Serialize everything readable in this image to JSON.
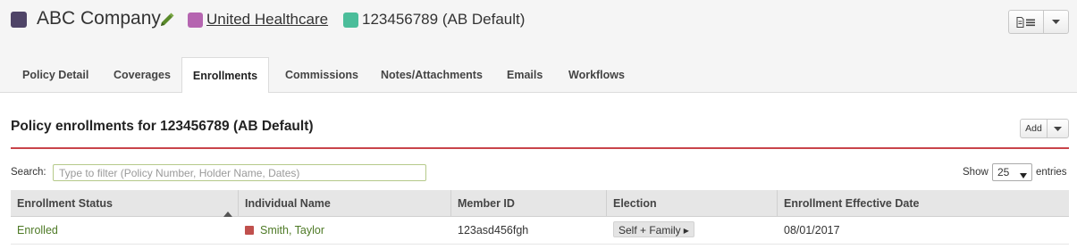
{
  "header": {
    "company_name": "ABC Company",
    "company_color": "#4f4467",
    "carrier_name": "United Healthcare",
    "carrier_color": "#b565b0",
    "plan_name": "123456789 (AB Default)",
    "plan_color": "#4bbd9a",
    "edit_icon": "pencil-icon",
    "menu_icon": "document-list-icon"
  },
  "tabs": [
    {
      "label": "Policy Detail",
      "active": false
    },
    {
      "label": "Coverages",
      "active": false
    },
    {
      "label": "Enrollments",
      "active": true
    },
    {
      "label": "Commissions",
      "active": false
    },
    {
      "label": "Notes/Attachments",
      "active": false
    },
    {
      "label": "Emails",
      "active": false
    },
    {
      "label": "Workflows",
      "active": false
    }
  ],
  "section": {
    "title": "Policy enrollments for 123456789 (AB Default)",
    "add_label": "Add",
    "accent_color": "#c9444a"
  },
  "search": {
    "label": "Search:",
    "placeholder": "Type to filter (Policy Number, Holder Name, Dates)",
    "value": ""
  },
  "paging": {
    "show_label": "Show",
    "page_size": "25",
    "entries_label": "entries"
  },
  "table": {
    "columns": [
      "Enrollment Status",
      "Individual Name",
      "Member ID",
      "Election",
      "Enrollment Effective Date"
    ],
    "sorted_column": "Enrollment Status",
    "sort_direction": "ascending",
    "rows": [
      {
        "status": "Enrolled",
        "name": "Smith, Taylor",
        "name_color": "#c0504d",
        "member_id": "123asd456fgh",
        "election": "Self + Family",
        "effective_date": "08/01/2017"
      }
    ]
  }
}
